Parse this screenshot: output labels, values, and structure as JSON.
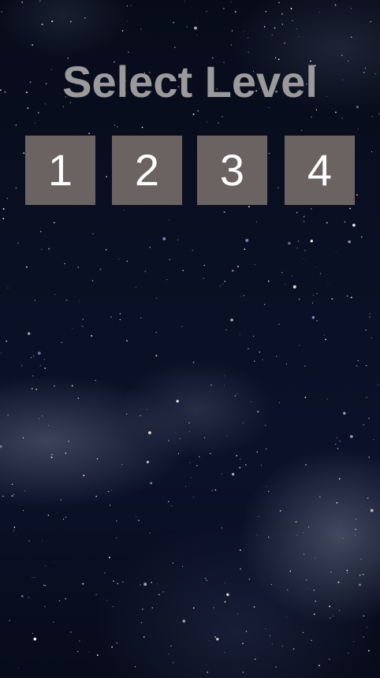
{
  "screen": {
    "title": "Select Level"
  },
  "levels": [
    {
      "label": "1"
    },
    {
      "label": "2"
    },
    {
      "label": "3"
    },
    {
      "label": "4"
    }
  ],
  "colors": {
    "title_text": "#9a9a9a",
    "button_background": "#6b6361",
    "button_text": "#ffffff",
    "background": "#0a1024"
  },
  "background_image": "starry-night-sky"
}
